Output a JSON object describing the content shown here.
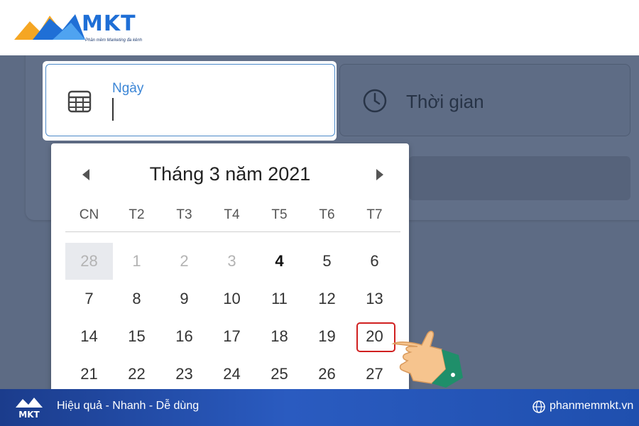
{
  "brand": {
    "name": "MKT",
    "tagline": "Phần mềm Marketing đa kênh",
    "colors": {
      "primary": "#1f6fd6",
      "accent": "#f5a623"
    }
  },
  "form": {
    "date_label": "Ngày",
    "date_value": "",
    "time_label": "Thời gian"
  },
  "calendar": {
    "title": "Tháng 3 năm 2021",
    "prev_icon": "triangle-left-icon",
    "next_icon": "triangle-right-icon",
    "weekdays": [
      "CN",
      "T2",
      "T3",
      "T4",
      "T5",
      "T6",
      "T7"
    ],
    "weeks": [
      [
        "28",
        "1",
        "2",
        "3",
        "4",
        "5",
        "6"
      ],
      [
        "7",
        "8",
        "9",
        "10",
        "11",
        "12",
        "13"
      ],
      [
        "14",
        "15",
        "16",
        "17",
        "18",
        "19",
        "20"
      ],
      [
        "21",
        "22",
        "23",
        "24",
        "25",
        "26",
        "27"
      ]
    ],
    "disabled_days": [
      "28",
      "1",
      "2",
      "3"
    ],
    "today": "4",
    "highlighted": "20",
    "highlight_color": "#d02020"
  },
  "footer": {
    "logo_text": "MKT",
    "slogan": "Hiệu quả - Nhanh  - Dễ dùng",
    "website": "phanmemmkt.vn"
  }
}
